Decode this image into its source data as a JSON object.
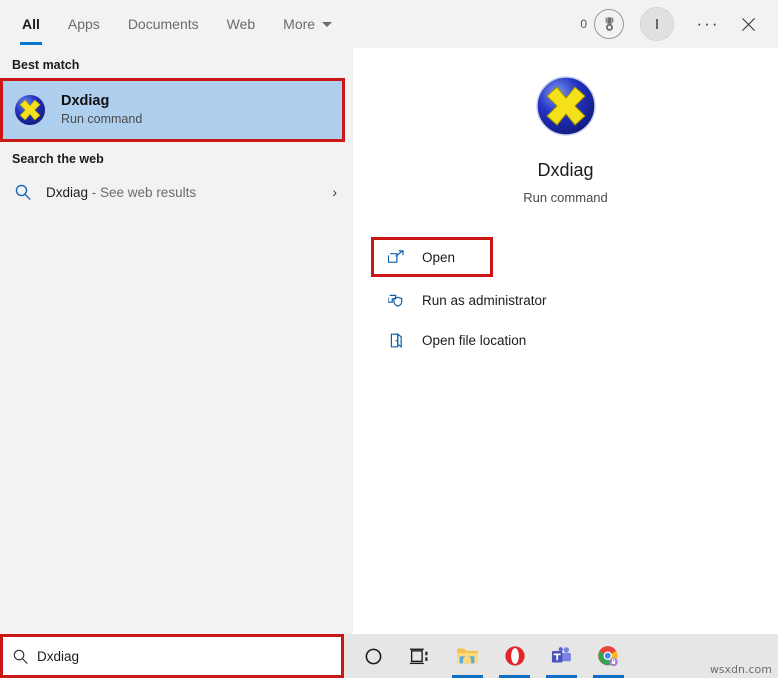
{
  "tabs": [
    {
      "label": "All",
      "active": true
    },
    {
      "label": "Apps",
      "active": false
    },
    {
      "label": "Documents",
      "active": false
    },
    {
      "label": "Web",
      "active": false
    },
    {
      "label": "More",
      "active": false,
      "has_caret": true
    }
  ],
  "header": {
    "rewards_count": "0",
    "rewards_icon": "medal-icon",
    "avatar_initial": "I",
    "more_options_label": "···",
    "close_label": "✕"
  },
  "left_panel": {
    "best_match_title": "Best match",
    "best_match": {
      "title": "Dxdiag",
      "subtitle": "Run command",
      "icon": "dxdiag-icon",
      "selected": true,
      "highlighted": true
    },
    "search_web_title": "Search the web",
    "web_result": {
      "query": "Dxdiag",
      "suffix": " - See web results",
      "icon": "search-icon",
      "chevron": "›"
    }
  },
  "right_panel": {
    "app_icon": "dxdiag-icon",
    "app_name": "Dxdiag",
    "app_subtitle": "Run command",
    "actions": [
      {
        "label": "Open",
        "icon": "open-external-icon",
        "highlighted": true
      },
      {
        "label": "Run as administrator",
        "icon": "shield-run-icon",
        "highlighted": false
      },
      {
        "label": "Open file location",
        "icon": "open-folder-icon",
        "highlighted": false
      }
    ]
  },
  "bottom_bar": {
    "search": {
      "value": "Dxdiag",
      "placeholder": "Type here to search",
      "icon": "search-icon",
      "highlighted": true
    },
    "taskbar_items": [
      {
        "name": "cortana-icon",
        "open": false
      },
      {
        "name": "task-view-icon",
        "open": false
      },
      {
        "name": "file-explorer-icon",
        "open": true
      },
      {
        "name": "opera-icon",
        "open": true
      },
      {
        "name": "microsoft-teams-icon",
        "open": true
      },
      {
        "name": "google-chrome-icon",
        "open": true
      }
    ],
    "watermark": "wsxdn.com"
  },
  "colors": {
    "accent_blue": "#0078d4",
    "highlight_red": "#cc1717",
    "selection_blue": "#aed0ee",
    "panel_gray": "#f2f2f2",
    "taskbar_gray": "#e6e6e6",
    "icon_blue": "#0d5fa8"
  }
}
